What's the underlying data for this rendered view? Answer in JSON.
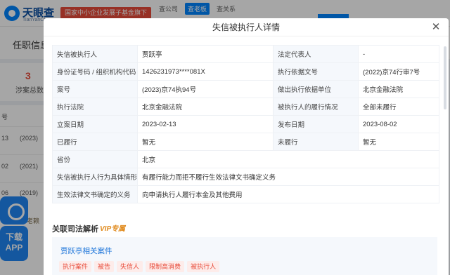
{
  "background": {
    "logo_text": "天眼查",
    "logo_sub": "TianYanCha.com",
    "gov_badge": "国家中小企业发展子基金旗下",
    "top_tabs": [
      "查公司",
      "查老板",
      "查关系"
    ],
    "nav_item": "任职信息",
    "stat_num": "3",
    "stat_label": "涉案总数",
    "rows": [
      {
        "a": "13",
        "b": "(2023)"
      },
      {
        "a": "02",
        "b": "(2021)"
      },
      {
        "a": "06",
        "b": "(2019)"
      }
    ],
    "row_header": "号",
    "float_app_line1": "下载",
    "float_app_line2": "APP",
    "lawyer": "老赖"
  },
  "modal": {
    "title": "失信被执行人详情",
    "close_icon": "close-icon",
    "rows": [
      {
        "k1": "失信被执行人",
        "v1": "贾跃亭",
        "k2": "法定代表人",
        "v2": "-"
      },
      {
        "k1": "身份证号码 / 组织机构代码",
        "v1": "1426231973****081X",
        "k2": "执行依据文号",
        "v2": "(2022)京74行审7号"
      },
      {
        "k1": "案号",
        "v1": "(2023)京74执94号",
        "k2": "做出执行依据单位",
        "v2": "北京金融法院"
      },
      {
        "k1": "执行法院",
        "v1": "北京金融法院",
        "k2": "被执行人的履行情况",
        "v2": "全部未履行"
      },
      {
        "k1": "立案日期",
        "v1": "2023-02-13",
        "k2": "发布日期",
        "v2": "2023-08-02"
      },
      {
        "k1": "已履行",
        "v1": "暂无",
        "k2": "未履行",
        "v2": "暂无"
      }
    ],
    "full_rows": [
      {
        "k": "省份",
        "v": "北京"
      },
      {
        "k": "失信被执行人行为具体情形",
        "v": "有履行能力而拒不履行生效法律文书确定义务"
      },
      {
        "k": "生效法律文书确定的义务",
        "v": "向申请执行人履行本金及其他费用"
      }
    ],
    "section_title": "关联司法解析",
    "vip_label": "VIP专属",
    "case_title": "贾跃亭相关案件",
    "tags": [
      "执行案件",
      "被告",
      "失信人",
      "限制高消费",
      "被执行人"
    ]
  },
  "colors": {
    "accent": "#0084ff",
    "danger": "#e84b3a",
    "vip": "#e08a1c"
  }
}
